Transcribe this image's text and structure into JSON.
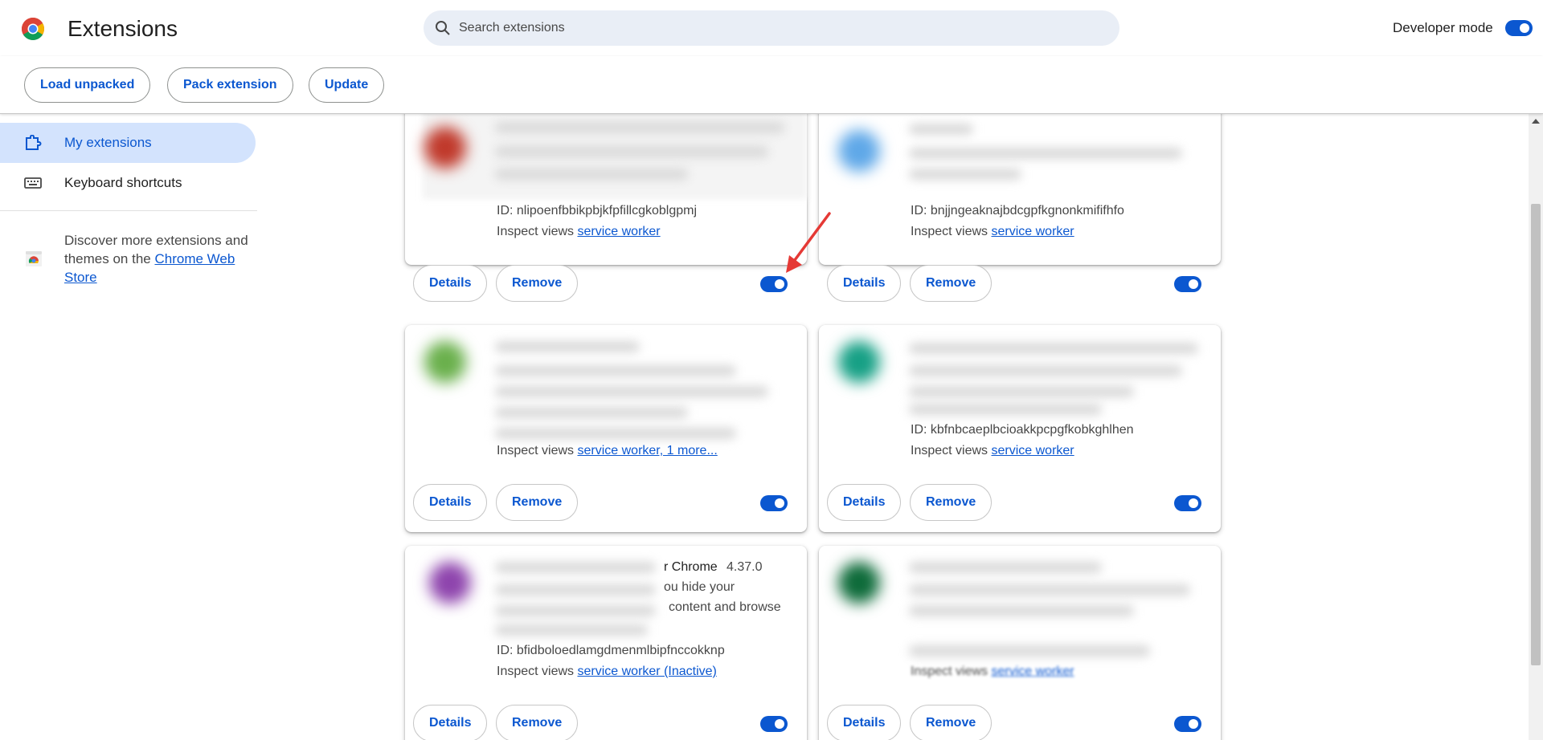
{
  "header": {
    "title": "Extensions",
    "search_placeholder": "Search extensions",
    "developer_mode_label": "Developer mode",
    "developer_mode_on": true
  },
  "toolbar": {
    "load_unpacked": "Load unpacked",
    "pack_extension": "Pack extension",
    "update": "Update"
  },
  "sidebar": {
    "items": [
      {
        "label": "My extensions",
        "active": true
      },
      {
        "label": "Keyboard shortcuts",
        "active": false
      }
    ],
    "discover_text": "Discover more extensions and themes on the ",
    "store_link": "Chrome Web Store"
  },
  "cards": [
    {
      "id_text": "ID: nlipoenfbbikpbjkfpfillcgkoblgpmj",
      "inspect_label": "Inspect views",
      "inspect_link": "service worker",
      "details": "Details",
      "remove": "Remove",
      "enabled": true,
      "icon_color": "#c0392b"
    },
    {
      "id_text": "ID: bnjjngeaknajbdcgpfkgnonkmififhfo",
      "inspect_label": "Inspect views",
      "inspect_link": "service worker",
      "details": "Details",
      "remove": "Remove",
      "enabled": true,
      "icon_color": "#5fa8e8"
    },
    {
      "id_text": "",
      "inspect_label": "Inspect views",
      "inspect_link": "service worker, 1 more...",
      "details": "Details",
      "remove": "Remove",
      "enabled": true,
      "icon_color": "#6ab04c"
    },
    {
      "id_text": "ID: kbfnbcaeplbcioakkpcpgfkobkghlhen",
      "inspect_label": "Inspect views",
      "inspect_link": "service worker",
      "details": "Details",
      "remove": "Remove",
      "enabled": true,
      "icon_color": "#16a085"
    },
    {
      "id_text": "ID: bfidboloedlamgdmenmlbipfnccokknp",
      "inspect_label": "Inspect views",
      "inspect_link": "service worker (Inactive)",
      "details": "Details",
      "remove": "Remove",
      "enabled": true,
      "icon_color": "#8e44ad",
      "title_fragment": "r Chrome",
      "version": "4.37.0",
      "desc_line1": "ou hide your",
      "desc_line2": "content and browse"
    },
    {
      "id_text": "",
      "inspect_label": "Inspect views",
      "inspect_link": "service worker",
      "details": "Details",
      "remove": "Remove",
      "enabled": true,
      "icon_color": "#0e6b3a"
    }
  ],
  "colors": {
    "accent": "#0b57d0",
    "active_nav": "#d3e3fd",
    "search_bg": "#e9eef6",
    "annotation": "#e53935"
  }
}
